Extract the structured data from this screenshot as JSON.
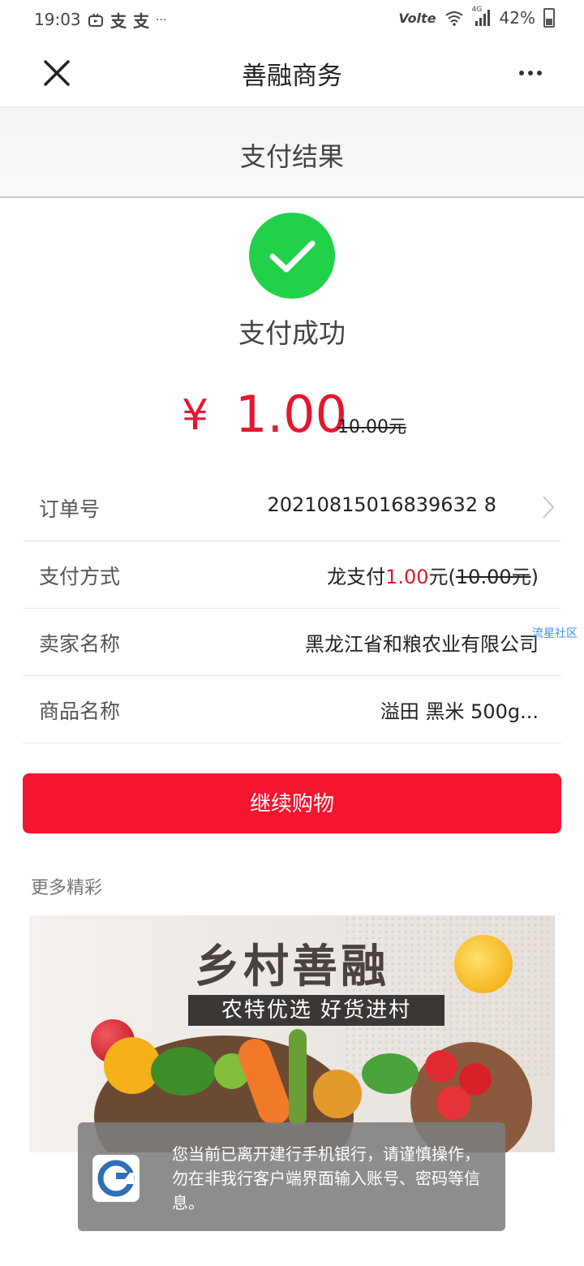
{
  "status_bar": {
    "time": "19:03",
    "app_icons": [
      "bilibili-icon",
      "alipay-icon",
      "alipay-icon"
    ],
    "more_indicator": "···",
    "volte": "Volte",
    "network": "4G",
    "battery": "42%"
  },
  "nav": {
    "title": "善融商务"
  },
  "page": {
    "title": "支付结果"
  },
  "result": {
    "status_text": "支付成功",
    "currency_symbol": "¥",
    "amount": "1.00",
    "original_amount": "10.00元"
  },
  "details": {
    "order_no": {
      "label": "订单号",
      "value": "20210815016839632 8"
    },
    "payment_method": {
      "label": "支付方式",
      "prefix": "龙支付",
      "amount": "1.00",
      "unit": "元(",
      "original": "10.00元",
      "suffix": ")"
    },
    "seller": {
      "label": "卖家名称",
      "value": "黑龙江省和粮农业有限公司"
    },
    "product": {
      "label": "商品名称",
      "value": "溢田 黑米 500g..."
    }
  },
  "watermark": "流星社区",
  "actions": {
    "continue_label": "继续购物"
  },
  "more": {
    "title": "更多精彩",
    "banner_title": "乡村善融",
    "banner_subtitle": "农特优选 好货进村"
  },
  "toast": {
    "message": "您当前已离开建行手机银行，请谨慎操作，勿在非我行客户端界面输入账号、密码等信息。"
  },
  "colors": {
    "accent_red": "#f4152f",
    "success_green": "#22d14a"
  }
}
